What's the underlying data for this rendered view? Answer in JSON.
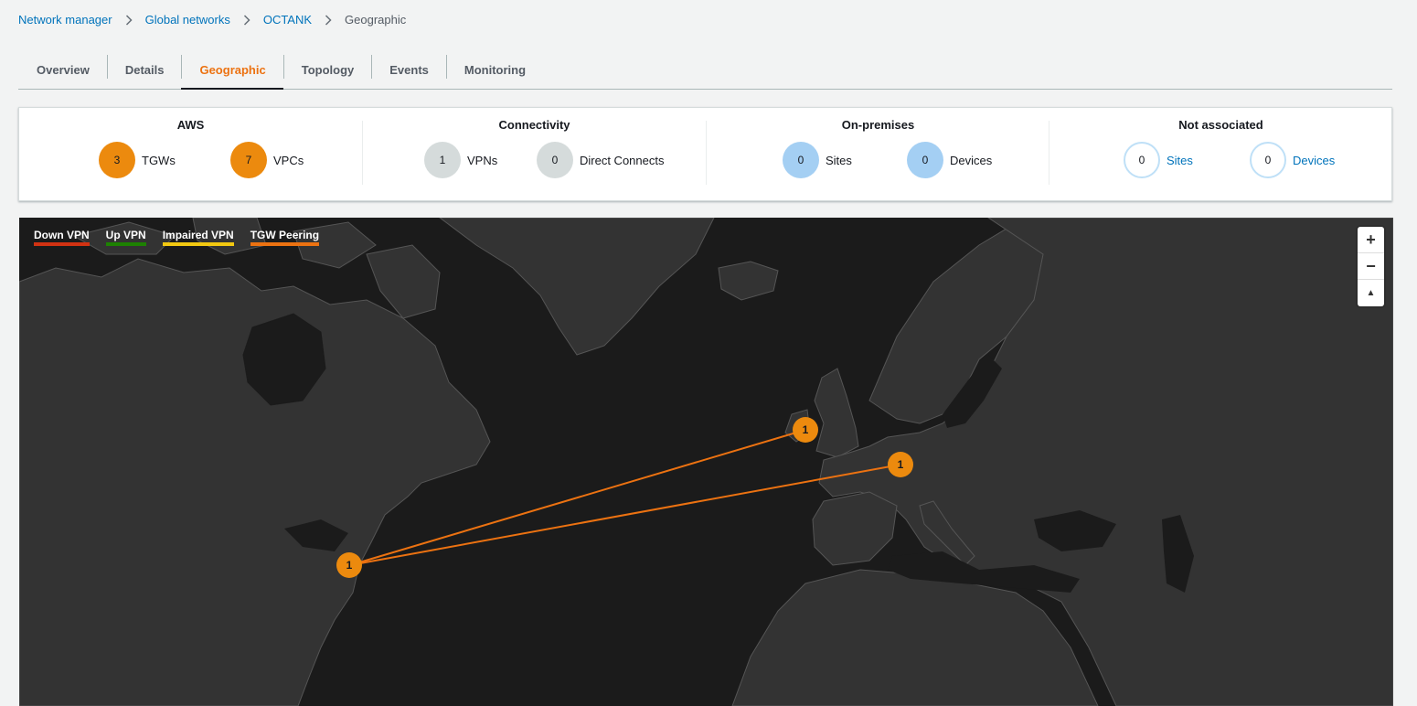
{
  "breadcrumb": {
    "items": [
      "Network manager",
      "Global networks",
      "OCTANK"
    ],
    "current": "Geographic"
  },
  "tabs": [
    "Overview",
    "Details",
    "Geographic",
    "Topology",
    "Events",
    "Monitoring"
  ],
  "active_tab": "Geographic",
  "summary": {
    "aws": {
      "title": "AWS",
      "tgw_count": "3",
      "tgw_label": "TGWs",
      "vpc_count": "7",
      "vpc_label": "VPCs"
    },
    "connectivity": {
      "title": "Connectivity",
      "vpn_count": "1",
      "vpn_label": "VPNs",
      "dc_count": "0",
      "dc_label": "Direct Connects"
    },
    "on_premises": {
      "title": "On-premises",
      "sites_count": "0",
      "sites_label": "Sites",
      "devices_count": "0",
      "devices_label": "Devices"
    },
    "not_associated": {
      "title": "Not associated",
      "sites_count": "0",
      "sites_label": "Sites",
      "devices_count": "0",
      "devices_label": "Devices"
    }
  },
  "map": {
    "legend": [
      {
        "label": "Down VPN",
        "color": "#d13212"
      },
      {
        "label": "Up VPN",
        "color": "#1d8102"
      },
      {
        "label": "Impaired VPN",
        "color": "#f2c811"
      },
      {
        "label": "TGW Peering",
        "color": "#ec7211"
      }
    ],
    "zoom_in": "+",
    "zoom_out": "−",
    "reset_north": "▲",
    "markers": [
      {
        "id": "us-east",
        "count": "1"
      },
      {
        "id": "eu-west-london",
        "count": "1"
      },
      {
        "id": "eu-central-frankfurt",
        "count": "1"
      }
    ],
    "colors": {
      "ocean": "#1b1b1b",
      "land": "#333333",
      "border": "#555555",
      "peering": "#ec7211"
    }
  }
}
